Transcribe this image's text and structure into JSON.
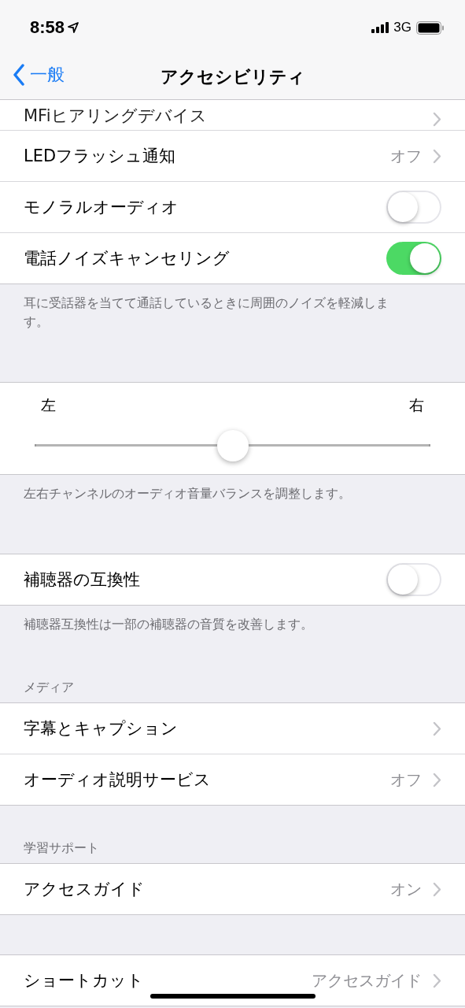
{
  "status_bar": {
    "time": "8:58",
    "network": "3G"
  },
  "nav": {
    "back": "一般",
    "title": "アクセシビリティ"
  },
  "sections": [
    {
      "kind": "list",
      "peek": true,
      "rows": [
        {
          "kind": "link",
          "label": "MFiヒアリングデバイス"
        },
        {
          "kind": "link",
          "label": "LEDフラッシュ通知",
          "value": "オフ"
        },
        {
          "kind": "toggle",
          "label": "モノラルオーディオ",
          "on": false
        },
        {
          "kind": "toggle",
          "label": "電話ノイズキャンセリング",
          "on": true
        }
      ],
      "footer": "耳に受話器を当てて通話しているときに周囲のノイズを軽減します。"
    },
    {
      "kind": "balance",
      "left": "左",
      "right": "右",
      "level": 0.5,
      "footer": "左右チャンネルのオーディオ音量バランスを調整します。"
    },
    {
      "kind": "list",
      "rows": [
        {
          "kind": "toggle",
          "label": "補聴器の互換性",
          "on": false
        }
      ],
      "footer": "補聴器互換性は一部の補聴器の音質を改善します。"
    },
    {
      "kind": "list",
      "header": "メディア",
      "rows": [
        {
          "kind": "link",
          "label": "字幕とキャプション"
        },
        {
          "kind": "link",
          "label": "オーディオ説明サービス",
          "value": "オフ"
        }
      ]
    },
    {
      "kind": "list",
      "header": "学習サポート",
      "rows": [
        {
          "kind": "link",
          "label": "アクセスガイド",
          "value": "オン"
        }
      ]
    },
    {
      "kind": "list",
      "rows": [
        {
          "kind": "link",
          "label": "ショートカット",
          "value": "アクセスガイド"
        }
      ]
    }
  ]
}
